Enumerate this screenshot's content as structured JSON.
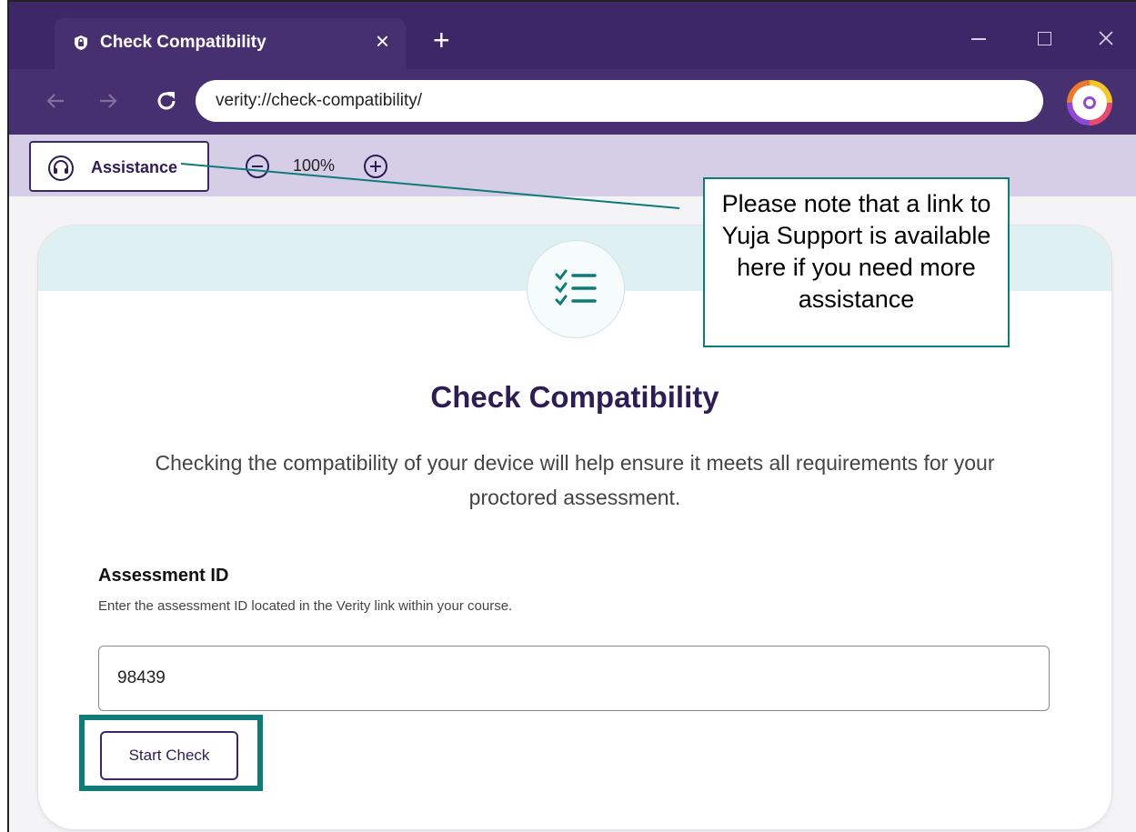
{
  "browser": {
    "tab_title": "Check Compatibility",
    "tab_close": "×",
    "new_tab": "+",
    "url": "verity://check-compatibility/",
    "accent_color": "#3d2766"
  },
  "toolbar": {
    "assistance_label": "Assistance",
    "zoom_level": "100%"
  },
  "page": {
    "title": "Check Compatibility",
    "description": "Checking the compatibility of your device will help ensure it meets all requirements for your proctored assessment.",
    "assessment_label": "Assessment ID",
    "assessment_help": "Enter the assessment ID located in the Verity link within your course.",
    "assessment_value": "98439",
    "start_button": "Start Check"
  },
  "annotation": {
    "callout_text": "Please note that a link to Yuja Support is available here if you need more assistance",
    "highlight_color": "#0f7b78"
  },
  "icons": [
    "shield-lock-icon",
    "back-arrow-icon",
    "forward-arrow-icon",
    "reload-icon",
    "profile-icon",
    "headset-icon",
    "zoom-out-icon",
    "zoom-in-icon",
    "checklist-icon",
    "minimize-icon",
    "maximize-icon",
    "close-icon"
  ]
}
